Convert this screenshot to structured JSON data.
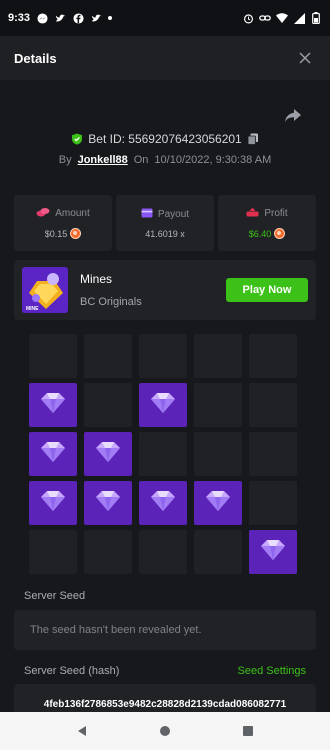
{
  "status_bar": {
    "time": "9:33",
    "left_icons": [
      "messenger-icon",
      "bird-icon",
      "facebook-icon",
      "bird-icon"
    ],
    "right_icons": [
      "alarm-icon",
      "link-icon",
      "wifi-icon",
      "signal-icon",
      "battery-icon"
    ]
  },
  "header": {
    "title": "Details",
    "close_icon": "close-icon"
  },
  "bet": {
    "id_label": "Bet ID: 55692076423056201",
    "by_label": "By",
    "user": "Jonkell88",
    "on_label": "On",
    "datetime": "10/10/2022, 9:30:38 AM"
  },
  "stats": {
    "amount": {
      "label": "Amount",
      "value": "$0.15",
      "icon": "coins-icon",
      "color": "#e33b6d"
    },
    "payout": {
      "label": "Payout",
      "value": "41.6019 x",
      "icon": "card-icon",
      "color": "#8a56f3"
    },
    "profit": {
      "label": "Profit",
      "value": "$6.40",
      "icon": "profit-icon",
      "color": "#e0304f",
      "value_color": "#3bc117"
    }
  },
  "game": {
    "name": "Mines",
    "provider": "BC Originals",
    "thumb_text": "MINE",
    "play_label": "Play Now"
  },
  "board": {
    "rows": 5,
    "cols": 5,
    "tiles": [
      0,
      0,
      0,
      0,
      0,
      1,
      0,
      1,
      0,
      0,
      1,
      1,
      0,
      0,
      0,
      1,
      1,
      1,
      1,
      0,
      0,
      0,
      0,
      0,
      1
    ]
  },
  "seeds": {
    "server_seed_label": "Server Seed",
    "server_seed_value": "The seed hasn't been revealed yet.",
    "hash_label": "Server Seed (hash)",
    "seed_settings_label": "Seed Settings",
    "hash_value": "4feb136f2786853e9482c28828d2139cdad086082771"
  },
  "colors": {
    "accent_green": "#3bc117",
    "gem_tile": "#5b23b8",
    "background": "#17181b",
    "card": "#212226"
  }
}
